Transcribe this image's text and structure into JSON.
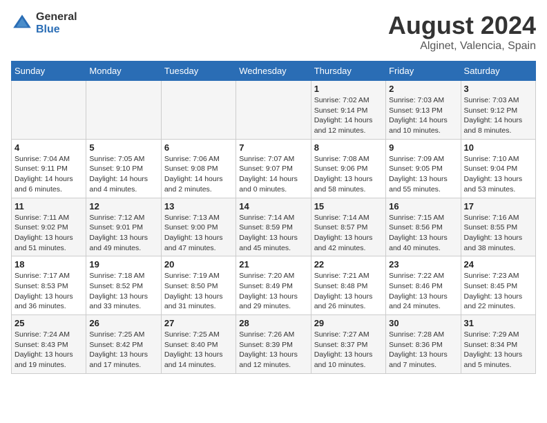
{
  "logo": {
    "general": "General",
    "blue": "Blue"
  },
  "title": {
    "month": "August 2024",
    "location": "Alginet, Valencia, Spain"
  },
  "weekdays": [
    "Sunday",
    "Monday",
    "Tuesday",
    "Wednesday",
    "Thursday",
    "Friday",
    "Saturday"
  ],
  "weeks": [
    [
      {
        "day": "",
        "content": ""
      },
      {
        "day": "",
        "content": ""
      },
      {
        "day": "",
        "content": ""
      },
      {
        "day": "",
        "content": ""
      },
      {
        "day": "1",
        "content": "Sunrise: 7:02 AM\nSunset: 9:14 PM\nDaylight: 14 hours\nand 12 minutes."
      },
      {
        "day": "2",
        "content": "Sunrise: 7:03 AM\nSunset: 9:13 PM\nDaylight: 14 hours\nand 10 minutes."
      },
      {
        "day": "3",
        "content": "Sunrise: 7:03 AM\nSunset: 9:12 PM\nDaylight: 14 hours\nand 8 minutes."
      }
    ],
    [
      {
        "day": "4",
        "content": "Sunrise: 7:04 AM\nSunset: 9:11 PM\nDaylight: 14 hours\nand 6 minutes."
      },
      {
        "day": "5",
        "content": "Sunrise: 7:05 AM\nSunset: 9:10 PM\nDaylight: 14 hours\nand 4 minutes."
      },
      {
        "day": "6",
        "content": "Sunrise: 7:06 AM\nSunset: 9:08 PM\nDaylight: 14 hours\nand 2 minutes."
      },
      {
        "day": "7",
        "content": "Sunrise: 7:07 AM\nSunset: 9:07 PM\nDaylight: 14 hours\nand 0 minutes."
      },
      {
        "day": "8",
        "content": "Sunrise: 7:08 AM\nSunset: 9:06 PM\nDaylight: 13 hours\nand 58 minutes."
      },
      {
        "day": "9",
        "content": "Sunrise: 7:09 AM\nSunset: 9:05 PM\nDaylight: 13 hours\nand 55 minutes."
      },
      {
        "day": "10",
        "content": "Sunrise: 7:10 AM\nSunset: 9:04 PM\nDaylight: 13 hours\nand 53 minutes."
      }
    ],
    [
      {
        "day": "11",
        "content": "Sunrise: 7:11 AM\nSunset: 9:02 PM\nDaylight: 13 hours\nand 51 minutes."
      },
      {
        "day": "12",
        "content": "Sunrise: 7:12 AM\nSunset: 9:01 PM\nDaylight: 13 hours\nand 49 minutes."
      },
      {
        "day": "13",
        "content": "Sunrise: 7:13 AM\nSunset: 9:00 PM\nDaylight: 13 hours\nand 47 minutes."
      },
      {
        "day": "14",
        "content": "Sunrise: 7:14 AM\nSunset: 8:59 PM\nDaylight: 13 hours\nand 45 minutes."
      },
      {
        "day": "15",
        "content": "Sunrise: 7:14 AM\nSunset: 8:57 PM\nDaylight: 13 hours\nand 42 minutes."
      },
      {
        "day": "16",
        "content": "Sunrise: 7:15 AM\nSunset: 8:56 PM\nDaylight: 13 hours\nand 40 minutes."
      },
      {
        "day": "17",
        "content": "Sunrise: 7:16 AM\nSunset: 8:55 PM\nDaylight: 13 hours\nand 38 minutes."
      }
    ],
    [
      {
        "day": "18",
        "content": "Sunrise: 7:17 AM\nSunset: 8:53 PM\nDaylight: 13 hours\nand 36 minutes."
      },
      {
        "day": "19",
        "content": "Sunrise: 7:18 AM\nSunset: 8:52 PM\nDaylight: 13 hours\nand 33 minutes."
      },
      {
        "day": "20",
        "content": "Sunrise: 7:19 AM\nSunset: 8:50 PM\nDaylight: 13 hours\nand 31 minutes."
      },
      {
        "day": "21",
        "content": "Sunrise: 7:20 AM\nSunset: 8:49 PM\nDaylight: 13 hours\nand 29 minutes."
      },
      {
        "day": "22",
        "content": "Sunrise: 7:21 AM\nSunset: 8:48 PM\nDaylight: 13 hours\nand 26 minutes."
      },
      {
        "day": "23",
        "content": "Sunrise: 7:22 AM\nSunset: 8:46 PM\nDaylight: 13 hours\nand 24 minutes."
      },
      {
        "day": "24",
        "content": "Sunrise: 7:23 AM\nSunset: 8:45 PM\nDaylight: 13 hours\nand 22 minutes."
      }
    ],
    [
      {
        "day": "25",
        "content": "Sunrise: 7:24 AM\nSunset: 8:43 PM\nDaylight: 13 hours\nand 19 minutes."
      },
      {
        "day": "26",
        "content": "Sunrise: 7:25 AM\nSunset: 8:42 PM\nDaylight: 13 hours\nand 17 minutes."
      },
      {
        "day": "27",
        "content": "Sunrise: 7:25 AM\nSunset: 8:40 PM\nDaylight: 13 hours\nand 14 minutes."
      },
      {
        "day": "28",
        "content": "Sunrise: 7:26 AM\nSunset: 8:39 PM\nDaylight: 13 hours\nand 12 minutes."
      },
      {
        "day": "29",
        "content": "Sunrise: 7:27 AM\nSunset: 8:37 PM\nDaylight: 13 hours\nand 10 minutes."
      },
      {
        "day": "30",
        "content": "Sunrise: 7:28 AM\nSunset: 8:36 PM\nDaylight: 13 hours\nand 7 minutes."
      },
      {
        "day": "31",
        "content": "Sunrise: 7:29 AM\nSunset: 8:34 PM\nDaylight: 13 hours\nand 5 minutes."
      }
    ]
  ]
}
